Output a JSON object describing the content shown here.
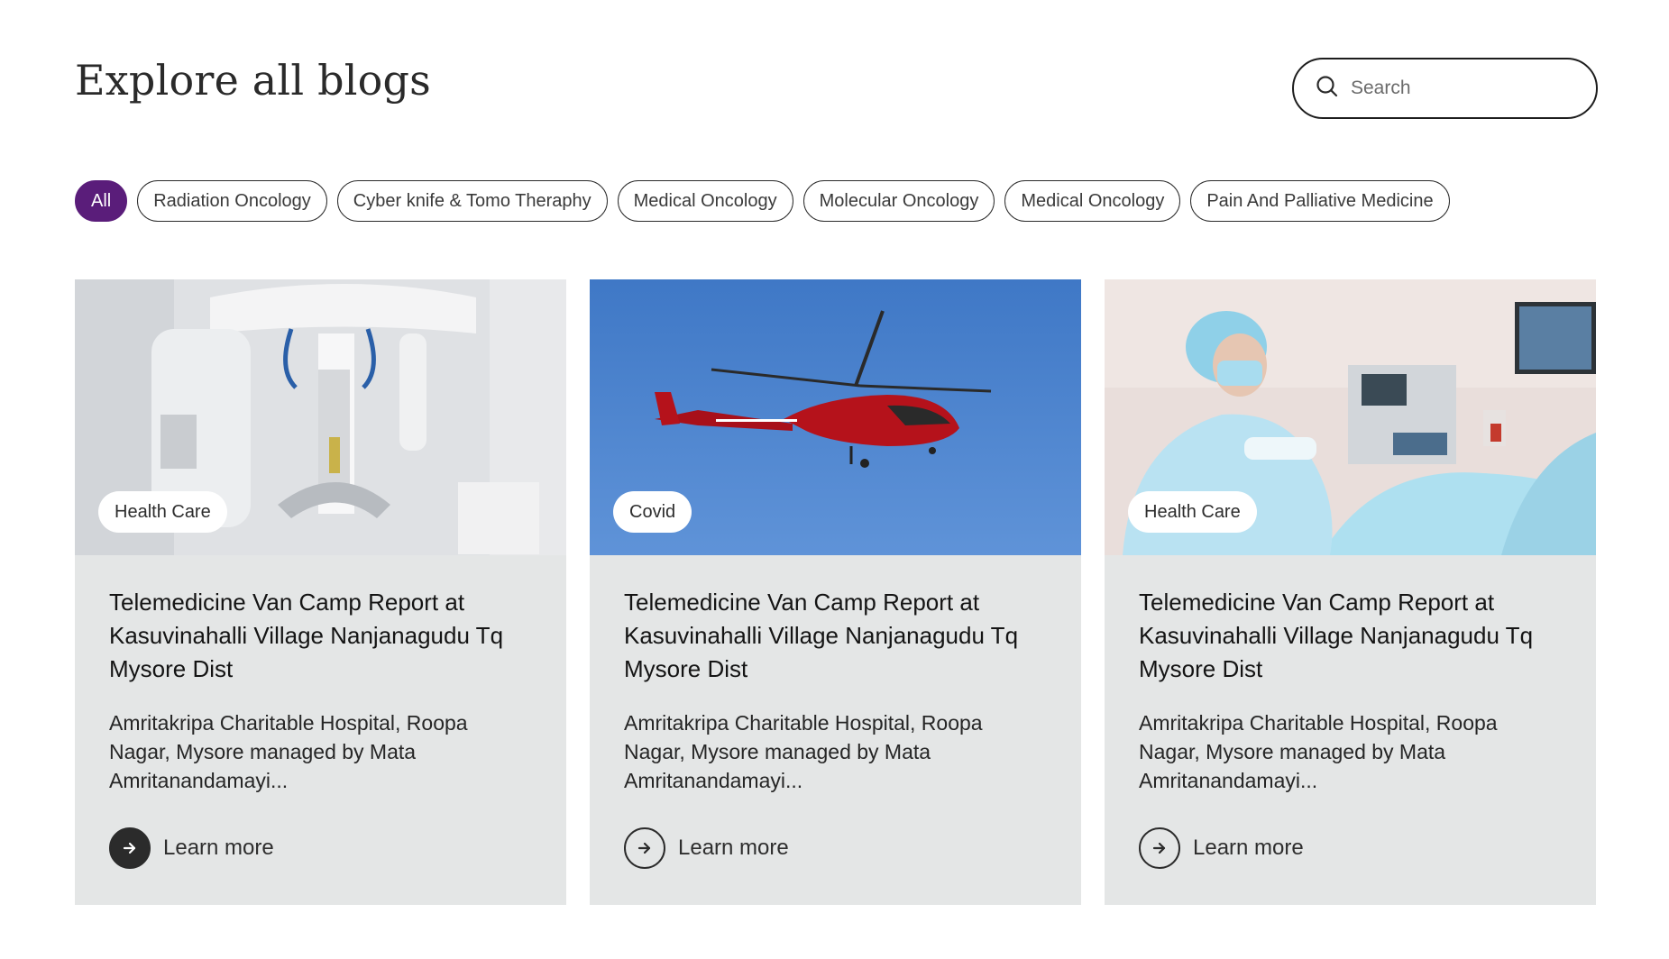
{
  "header": {
    "title": "Explore all blogs"
  },
  "search": {
    "placeholder": "Search",
    "icon": "search-icon"
  },
  "filters": [
    {
      "label": "All",
      "active": true
    },
    {
      "label": "Radiation Oncology"
    },
    {
      "label": "Cyber knife & Tomo Theraphy"
    },
    {
      "label": "Medical Oncology"
    },
    {
      "label": "Molecular Oncology"
    },
    {
      "label": "Medical Oncology"
    },
    {
      "label": "Pain And Palliative Medicine"
    }
  ],
  "colors": {
    "accent": "#5a1d7a",
    "card_bg": "#e4e6e6"
  },
  "cards": [
    {
      "tag": "Health Care",
      "image": "dental-imaging-machine-photo",
      "title": "Telemedicine Van Camp Report at Kasuvinahalli Village Nanjanagudu Tq Mysore Dist",
      "excerpt": "Amritakripa Charitable Hospital, Roopa Nagar, Mysore managed by Mata Amritanandamayi...",
      "link": "Learn more"
    },
    {
      "tag": "Covid",
      "image": "red-helicopter-sky-photo",
      "title": "Telemedicine Van Camp Report at Kasuvinahalli Village Nanjanagudu Tq Mysore Dist",
      "excerpt": "Amritakripa Charitable Hospital, Roopa Nagar, Mysore managed by Mata Amritanandamayi...",
      "link": "Learn more"
    },
    {
      "tag": "Health Care",
      "image": "surgeon-operating-room-photo",
      "title": "Telemedicine Van Camp Report at Kasuvinahalli Village Nanjanagudu Tq Mysore Dist",
      "excerpt": "Amritakripa Charitable Hospital, Roopa Nagar, Mysore managed by Mata Amritanandamayi...",
      "link": "Learn more"
    }
  ]
}
